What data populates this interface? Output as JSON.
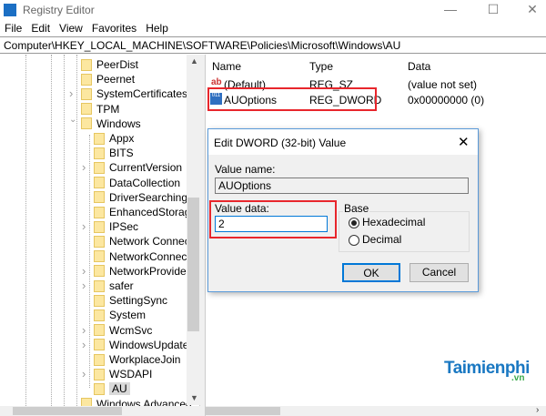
{
  "window": {
    "title": "Registry Editor",
    "minimize": "—",
    "maximize": "☐",
    "close": "✕"
  },
  "menu": [
    "File",
    "Edit",
    "View",
    "Favorites",
    "Help"
  ],
  "address": "Computer\\HKEY_LOCAL_MACHINE\\SOFTWARE\\Policies\\Microsoft\\Windows\\AU",
  "tree": [
    {
      "label": "PeerDist",
      "level": 1,
      "expandable": false
    },
    {
      "label": "Peernet",
      "level": 1,
      "expandable": false
    },
    {
      "label": "SystemCertificates",
      "level": 1,
      "expandable": true
    },
    {
      "label": "TPM",
      "level": 1,
      "expandable": false
    },
    {
      "label": "Windows",
      "level": 1,
      "expanded": true
    },
    {
      "label": "Appx",
      "level": 2,
      "expandable": false
    },
    {
      "label": "BITS",
      "level": 2,
      "expandable": false
    },
    {
      "label": "CurrentVersion",
      "level": 2,
      "expandable": true
    },
    {
      "label": "DataCollection",
      "level": 2,
      "expandable": false
    },
    {
      "label": "DriverSearching",
      "level": 2,
      "expandable": false
    },
    {
      "label": "EnhancedStorage",
      "level": 2,
      "expandable": false
    },
    {
      "label": "IPSec",
      "level": 2,
      "expandable": true
    },
    {
      "label": "Network Connect",
      "level": 2,
      "expandable": false
    },
    {
      "label": "NetworkConnecti",
      "level": 2,
      "expandable": false
    },
    {
      "label": "NetworkProvider",
      "level": 2,
      "expandable": true
    },
    {
      "label": "safer",
      "level": 2,
      "expandable": true
    },
    {
      "label": "SettingSync",
      "level": 2,
      "expandable": false
    },
    {
      "label": "System",
      "level": 2,
      "expandable": false
    },
    {
      "label": "WcmSvc",
      "level": 2,
      "expandable": true
    },
    {
      "label": "WindowsUpdate",
      "level": 2,
      "expandable": true
    },
    {
      "label": "WorkplaceJoin",
      "level": 2,
      "expandable": false
    },
    {
      "label": "WSDAPI",
      "level": 2,
      "expandable": true
    },
    {
      "label": "AU",
      "level": 2,
      "selected": true
    },
    {
      "label": "Windows Advanced",
      "level": 1,
      "expandable": false
    }
  ],
  "list": {
    "headers": [
      "Name",
      "Type",
      "Data"
    ],
    "rows": [
      {
        "name": "(Default)",
        "type": "REG_SZ",
        "data": "(value not set)",
        "icon": "ab"
      },
      {
        "name": "AUOptions",
        "type": "REG_DWORD",
        "data": "0x00000000 (0)",
        "icon": "011"
      }
    ]
  },
  "dialog": {
    "title": "Edit DWORD (32-bit) Value",
    "close": "✕",
    "value_name_label": "Value name:",
    "value_name": "AUOptions",
    "value_data_label": "Value data:",
    "value_data": "2",
    "base_label": "Base",
    "hex_label": "Hexadecimal",
    "dec_label": "Decimal",
    "base_selected": "Hexadecimal",
    "ok": "OK",
    "cancel": "Cancel"
  },
  "watermark": {
    "brand": "Taimienphi",
    "tld": ".vn"
  },
  "colors": {
    "highlight": "#e8262c",
    "accent": "#0078d7"
  }
}
